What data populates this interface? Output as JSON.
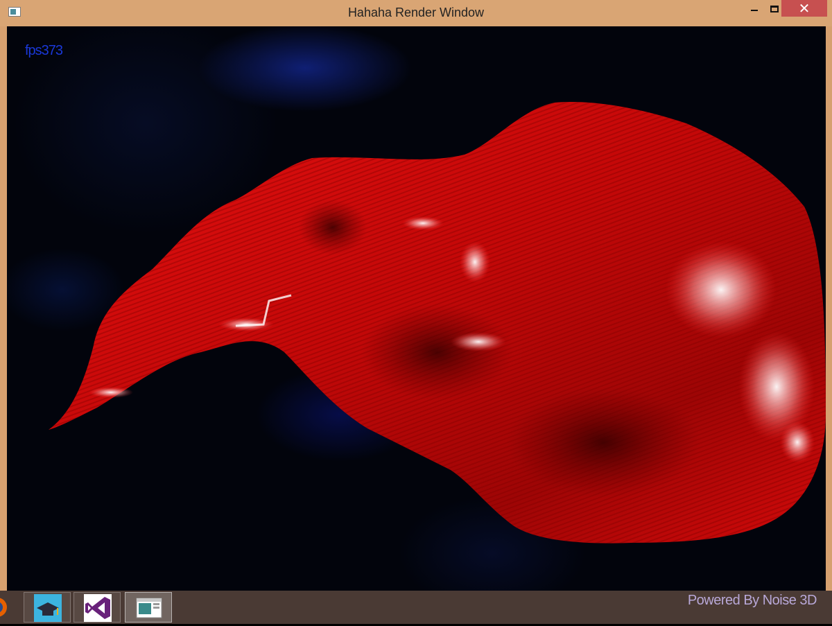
{
  "window": {
    "title": "Hahaha Render Window",
    "close_glyph": "✕",
    "app_icon": "render-window-icon"
  },
  "overlay": {
    "fps_text": "fps373",
    "powered_by": "Powered By Noise 3D"
  },
  "scene": {
    "object_color": "#cc0a0a",
    "highlight_color": "#ffffff",
    "background_color": "#02040c"
  },
  "taskbar": {
    "items": [
      {
        "icon": "firefox-icon"
      },
      {
        "icon": "graduation-cap-icon"
      },
      {
        "icon": "visual-studio-icon"
      },
      {
        "icon": "render-window-icon"
      }
    ]
  },
  "colors": {
    "title_bar": "#d9a574",
    "close_button": "#c75050",
    "fps_text": "#1a38d8",
    "powered_by_text": "#b8a8d8"
  }
}
